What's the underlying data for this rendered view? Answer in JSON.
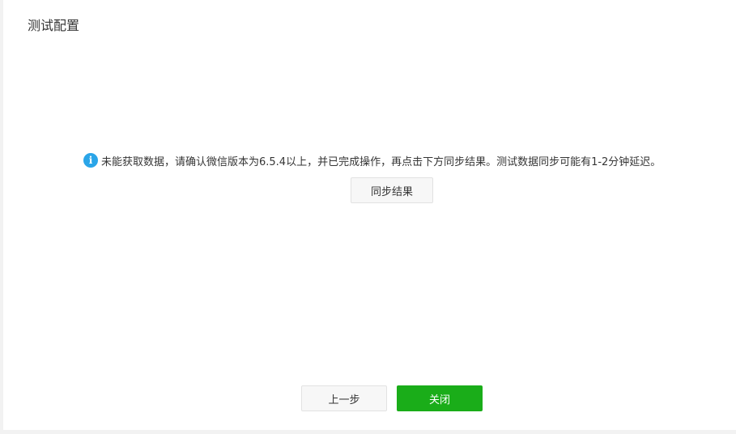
{
  "dialog": {
    "title": "测试配置"
  },
  "notice": {
    "icon": "info-icon",
    "icon_glyph": "i",
    "icon_color": "#2aa5e8",
    "text": "未能获取数据，请确认微信版本为6.5.4以上，并已完成操作，再点击下方同步结果。测试数据同步可能有1-2分钟延迟。"
  },
  "actions": {
    "sync_label": "同步结果"
  },
  "footer": {
    "prev_label": "上一步",
    "close_label": "关闭",
    "primary_color": "#1aad19"
  }
}
